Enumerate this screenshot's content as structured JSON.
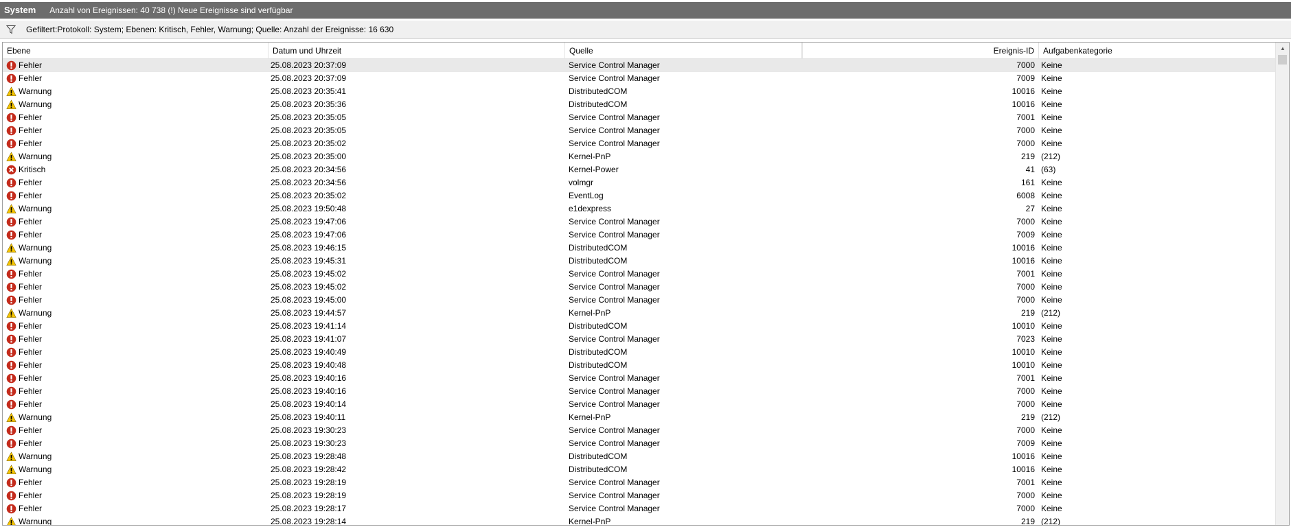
{
  "titlebar": {
    "name": "System",
    "info": "Anzahl von Ereignissen: 40 738 (!) Neue Ereignisse sind verfügbar"
  },
  "filterbar": {
    "icon": "filter-icon",
    "text": "Gefiltert:Protokoll: System; Ebenen: Kritisch, Fehler, Warnung; Quelle:  Anzahl der Ereignisse: 16 630"
  },
  "columns": {
    "level": "Ebene",
    "date": "Datum und Uhrzeit",
    "source": "Quelle",
    "blank": "",
    "event_id": "Ereignis-ID",
    "task": "Aufgabenkategorie"
  },
  "colors": {
    "error": "#c42b1c",
    "critical": "#c42b1c",
    "warning": "#f5c400",
    "titlebar": "#6d6d6d",
    "selected_row": "#e9e9e9"
  },
  "rows": [
    {
      "type": "error",
      "level": "Fehler",
      "date": "25.08.2023 20:37:09",
      "source": "Service Control Manager",
      "id": "7000",
      "task": "Keine"
    },
    {
      "type": "error",
      "level": "Fehler",
      "date": "25.08.2023 20:37:09",
      "source": "Service Control Manager",
      "id": "7009",
      "task": "Keine"
    },
    {
      "type": "warning",
      "level": "Warnung",
      "date": "25.08.2023 20:35:41",
      "source": "DistributedCOM",
      "id": "10016",
      "task": "Keine"
    },
    {
      "type": "warning",
      "level": "Warnung",
      "date": "25.08.2023 20:35:36",
      "source": "DistributedCOM",
      "id": "10016",
      "task": "Keine"
    },
    {
      "type": "error",
      "level": "Fehler",
      "date": "25.08.2023 20:35:05",
      "source": "Service Control Manager",
      "id": "7001",
      "task": "Keine"
    },
    {
      "type": "error",
      "level": "Fehler",
      "date": "25.08.2023 20:35:05",
      "source": "Service Control Manager",
      "id": "7000",
      "task": "Keine"
    },
    {
      "type": "error",
      "level": "Fehler",
      "date": "25.08.2023 20:35:02",
      "source": "Service Control Manager",
      "id": "7000",
      "task": "Keine"
    },
    {
      "type": "warning",
      "level": "Warnung",
      "date": "25.08.2023 20:35:00",
      "source": "Kernel-PnP",
      "id": "219",
      "task": "(212)"
    },
    {
      "type": "critical",
      "level": "Kritisch",
      "date": "25.08.2023 20:34:56",
      "source": "Kernel-Power",
      "id": "41",
      "task": "(63)"
    },
    {
      "type": "error",
      "level": "Fehler",
      "date": "25.08.2023 20:34:56",
      "source": "volmgr",
      "id": "161",
      "task": "Keine"
    },
    {
      "type": "error",
      "level": "Fehler",
      "date": "25.08.2023 20:35:02",
      "source": "EventLog",
      "id": "6008",
      "task": "Keine"
    },
    {
      "type": "warning",
      "level": "Warnung",
      "date": "25.08.2023 19:50:48",
      "source": "e1dexpress",
      "id": "27",
      "task": "Keine"
    },
    {
      "type": "error",
      "level": "Fehler",
      "date": "25.08.2023 19:47:06",
      "source": "Service Control Manager",
      "id": "7000",
      "task": "Keine"
    },
    {
      "type": "error",
      "level": "Fehler",
      "date": "25.08.2023 19:47:06",
      "source": "Service Control Manager",
      "id": "7009",
      "task": "Keine"
    },
    {
      "type": "warning",
      "level": "Warnung",
      "date": "25.08.2023 19:46:15",
      "source": "DistributedCOM",
      "id": "10016",
      "task": "Keine"
    },
    {
      "type": "warning",
      "level": "Warnung",
      "date": "25.08.2023 19:45:31",
      "source": "DistributedCOM",
      "id": "10016",
      "task": "Keine"
    },
    {
      "type": "error",
      "level": "Fehler",
      "date": "25.08.2023 19:45:02",
      "source": "Service Control Manager",
      "id": "7001",
      "task": "Keine"
    },
    {
      "type": "error",
      "level": "Fehler",
      "date": "25.08.2023 19:45:02",
      "source": "Service Control Manager",
      "id": "7000",
      "task": "Keine"
    },
    {
      "type": "error",
      "level": "Fehler",
      "date": "25.08.2023 19:45:00",
      "source": "Service Control Manager",
      "id": "7000",
      "task": "Keine"
    },
    {
      "type": "warning",
      "level": "Warnung",
      "date": "25.08.2023 19:44:57",
      "source": "Kernel-PnP",
      "id": "219",
      "task": "(212)"
    },
    {
      "type": "error",
      "level": "Fehler",
      "date": "25.08.2023 19:41:14",
      "source": "DistributedCOM",
      "id": "10010",
      "task": "Keine"
    },
    {
      "type": "error",
      "level": "Fehler",
      "date": "25.08.2023 19:41:07",
      "source": "Service Control Manager",
      "id": "7023",
      "task": "Keine"
    },
    {
      "type": "error",
      "level": "Fehler",
      "date": "25.08.2023 19:40:49",
      "source": "DistributedCOM",
      "id": "10010",
      "task": "Keine"
    },
    {
      "type": "error",
      "level": "Fehler",
      "date": "25.08.2023 19:40:48",
      "source": "DistributedCOM",
      "id": "10010",
      "task": "Keine"
    },
    {
      "type": "error",
      "level": "Fehler",
      "date": "25.08.2023 19:40:16",
      "source": "Service Control Manager",
      "id": "7001",
      "task": "Keine"
    },
    {
      "type": "error",
      "level": "Fehler",
      "date": "25.08.2023 19:40:16",
      "source": "Service Control Manager",
      "id": "7000",
      "task": "Keine"
    },
    {
      "type": "error",
      "level": "Fehler",
      "date": "25.08.2023 19:40:14",
      "source": "Service Control Manager",
      "id": "7000",
      "task": "Keine"
    },
    {
      "type": "warning",
      "level": "Warnung",
      "date": "25.08.2023 19:40:11",
      "source": "Kernel-PnP",
      "id": "219",
      "task": "(212)"
    },
    {
      "type": "error",
      "level": "Fehler",
      "date": "25.08.2023 19:30:23",
      "source": "Service Control Manager",
      "id": "7000",
      "task": "Keine"
    },
    {
      "type": "error",
      "level": "Fehler",
      "date": "25.08.2023 19:30:23",
      "source": "Service Control Manager",
      "id": "7009",
      "task": "Keine"
    },
    {
      "type": "warning",
      "level": "Warnung",
      "date": "25.08.2023 19:28:48",
      "source": "DistributedCOM",
      "id": "10016",
      "task": "Keine"
    },
    {
      "type": "warning",
      "level": "Warnung",
      "date": "25.08.2023 19:28:42",
      "source": "DistributedCOM",
      "id": "10016",
      "task": "Keine"
    },
    {
      "type": "error",
      "level": "Fehler",
      "date": "25.08.2023 19:28:19",
      "source": "Service Control Manager",
      "id": "7001",
      "task": "Keine"
    },
    {
      "type": "error",
      "level": "Fehler",
      "date": "25.08.2023 19:28:19",
      "source": "Service Control Manager",
      "id": "7000",
      "task": "Keine"
    },
    {
      "type": "error",
      "level": "Fehler",
      "date": "25.08.2023 19:28:17",
      "source": "Service Control Manager",
      "id": "7000",
      "task": "Keine"
    },
    {
      "type": "warning",
      "level": "Warnung",
      "date": "25.08.2023 19:28:14",
      "source": "Kernel-PnP",
      "id": "219",
      "task": "(212)"
    }
  ]
}
